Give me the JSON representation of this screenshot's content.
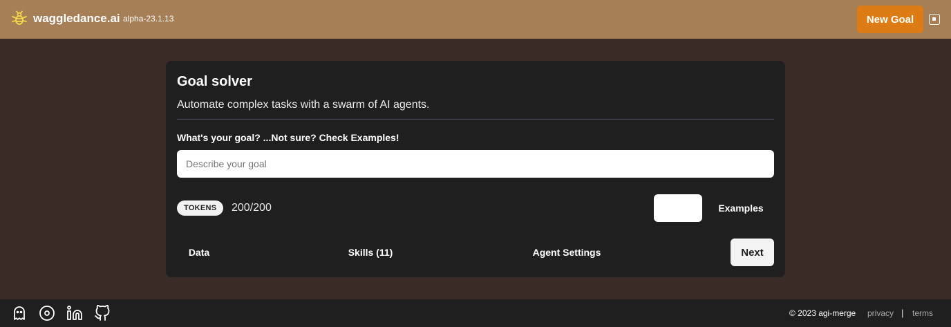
{
  "header": {
    "brand": "waggledance.ai",
    "version": "alpha-23.1.13",
    "new_goal_label": "New Goal",
    "accent_color": "#dd7b14",
    "background_color": "#a77f56",
    "icons": {
      "logo": "bee-icon",
      "toggle": "layout-toggle-icon"
    }
  },
  "goal_card": {
    "title": "Goal solver",
    "subtitle": "Automate complex tasks with a swarm of AI agents.",
    "goal_label": "What's your goal? ...Not sure? Check Examples!",
    "goal_input": {
      "value": "",
      "placeholder": "Describe your goal"
    },
    "tokens": {
      "badge": "TOKENS",
      "count": "200/200"
    },
    "examples_label": "Examples",
    "tabs": [
      {
        "label": "Data"
      },
      {
        "label": "Skills (11)"
      },
      {
        "label": "Agent Settings"
      }
    ],
    "next_label": "Next"
  },
  "footer": {
    "icons": [
      "ghost-icon",
      "disc-icon",
      "linkedin-icon",
      "github-icon"
    ],
    "copyright": "© 2023 agi-merge",
    "links": {
      "privacy": "privacy",
      "separator": "|",
      "terms": "terms"
    }
  }
}
